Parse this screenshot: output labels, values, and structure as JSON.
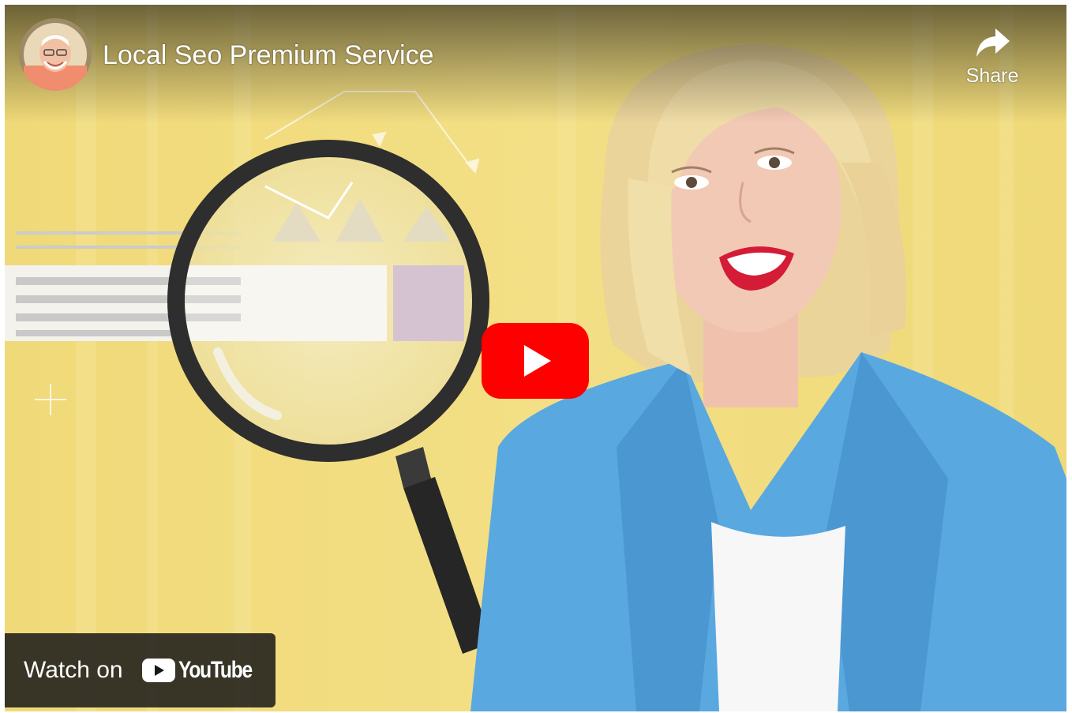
{
  "video": {
    "title": "Local Seo Premium Service",
    "share_label": "Share",
    "play_icon": "youtube-play-icon",
    "channel_avatar_icon": "channel-avatar"
  },
  "watch_on": {
    "label": "Watch on",
    "logo_text": "YouTube"
  },
  "colors": {
    "background_yellow": "#f1dc7c",
    "play_red": "#ff0000",
    "blazer_blue": "#5aa8e0",
    "magnifier_dark": "#2f2f2f",
    "search_button": "#c8b0c4"
  }
}
